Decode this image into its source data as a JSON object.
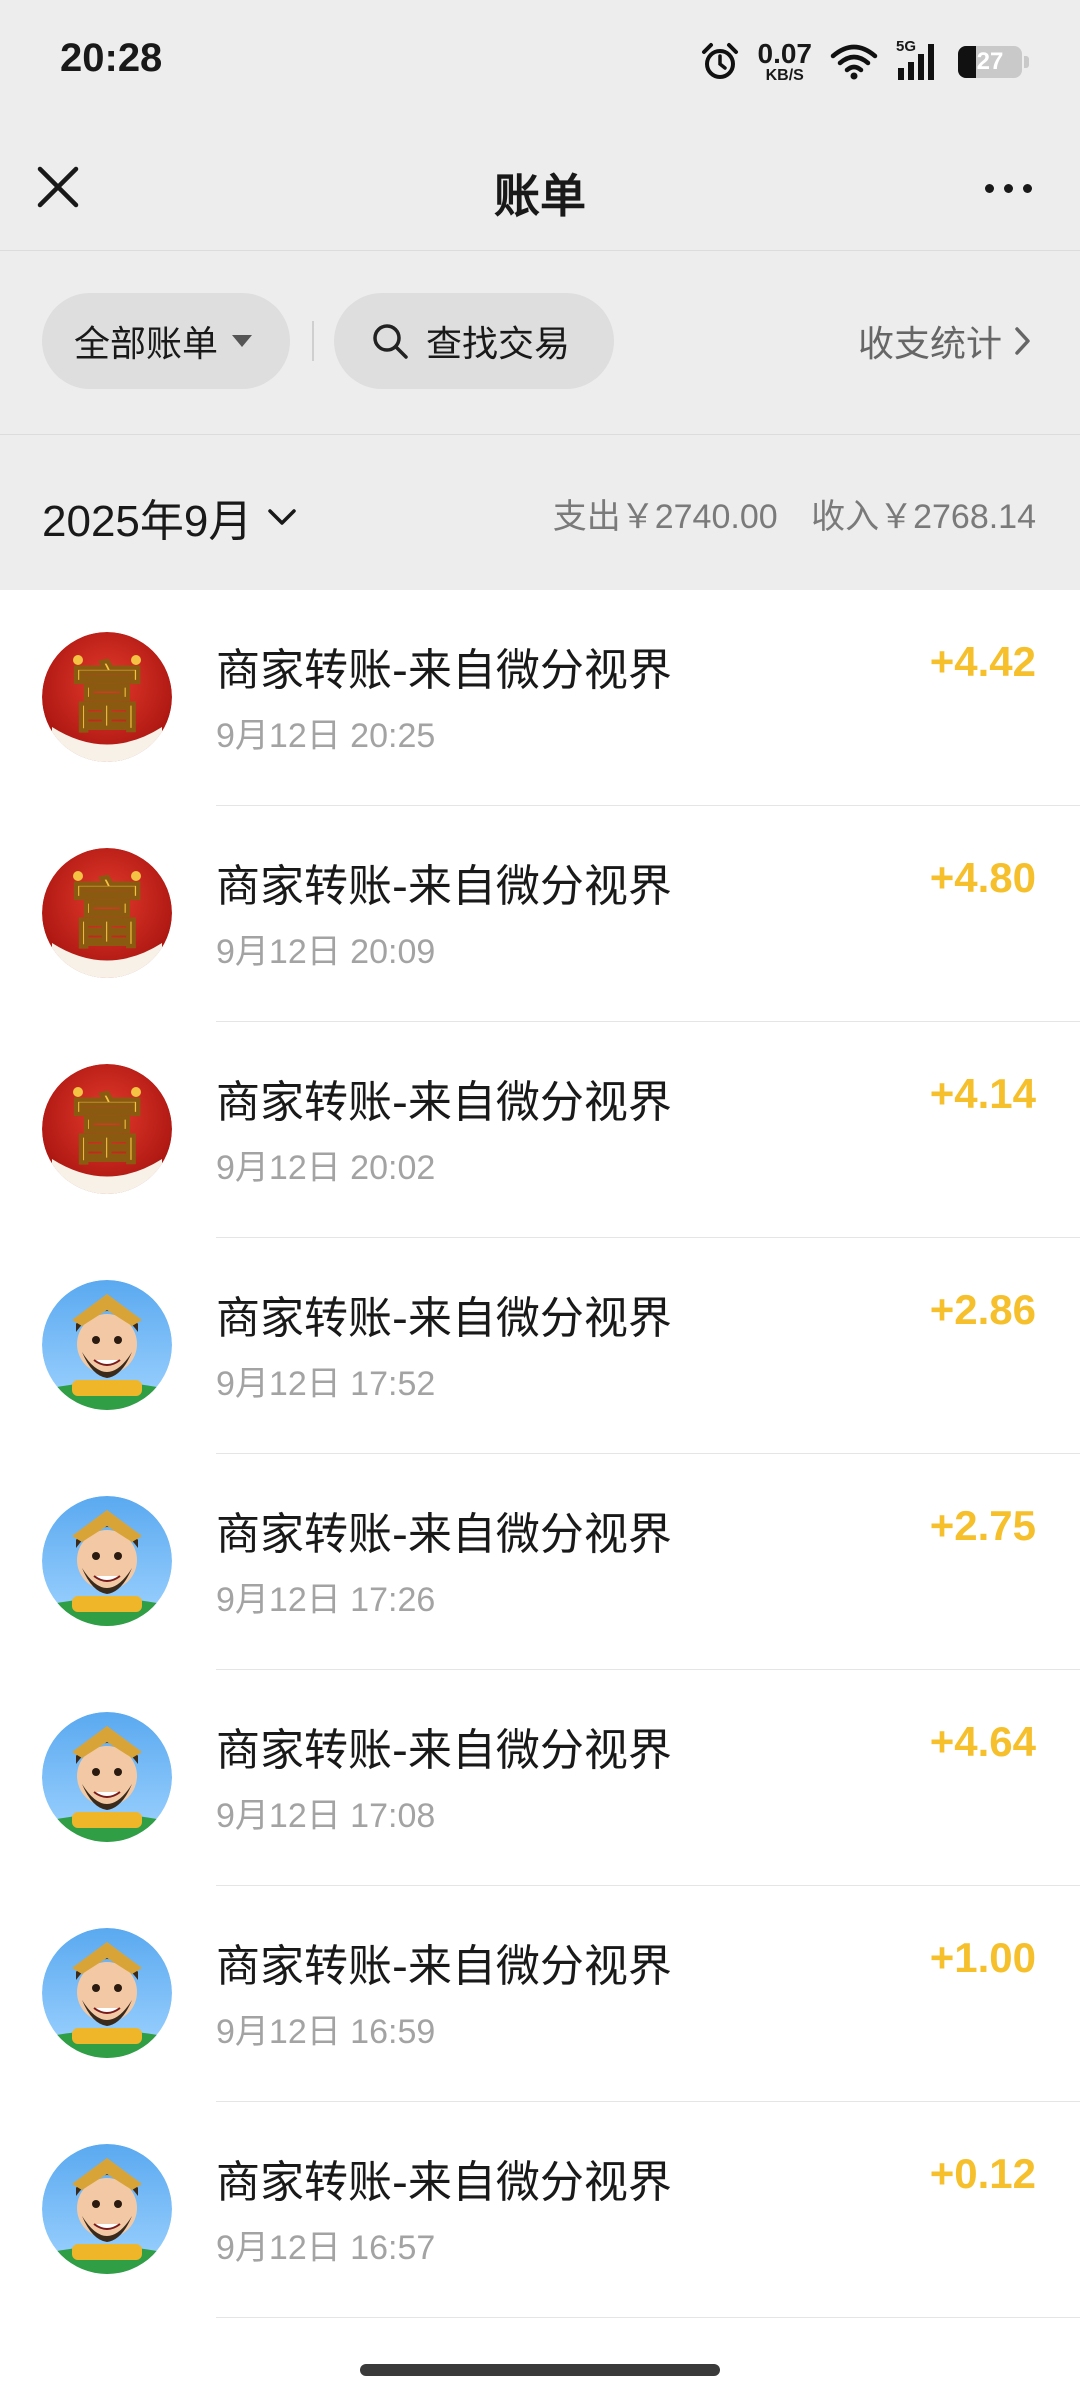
{
  "status_bar": {
    "time": "20:28",
    "net_speed_value": "0.07",
    "net_speed_unit": "KB/S",
    "network_type": "5G",
    "battery_level": "27",
    "icons": [
      "alarm-icon",
      "wifi-icon",
      "signal-icon",
      "battery-icon"
    ]
  },
  "nav": {
    "title": "账单",
    "close_icon": "close-icon",
    "more_icon": "more-icon"
  },
  "filters": {
    "all_bills_label": "全部账单",
    "search_label": "查找交易",
    "stats_label": "收支统计"
  },
  "month_header": {
    "month": "2025年9月",
    "expense": "支出￥2740.00",
    "income": "收入￥2768.14"
  },
  "transactions": [
    {
      "title": "商家转账-来自微分视界",
      "time": "9月12日 20:25",
      "amount": "+4.42",
      "avatar": "fu-avatar"
    },
    {
      "title": "商家转账-来自微分视界",
      "time": "9月12日 20:09",
      "amount": "+4.80",
      "avatar": "fu-avatar"
    },
    {
      "title": "商家转账-来自微分视界",
      "time": "9月12日 20:02",
      "amount": "+4.14",
      "avatar": "fu-avatar"
    },
    {
      "title": "商家转账-来自微分视界",
      "time": "9月12日 17:52",
      "amount": "+2.86",
      "avatar": "caishen-avatar"
    },
    {
      "title": "商家转账-来自微分视界",
      "time": "9月12日 17:26",
      "amount": "+2.75",
      "avatar": "caishen-avatar"
    },
    {
      "title": "商家转账-来自微分视界",
      "time": "9月12日 17:08",
      "amount": "+4.64",
      "avatar": "caishen-avatar"
    },
    {
      "title": "商家转账-来自微分视界",
      "time": "9月12日 16:59",
      "amount": "+1.00",
      "avatar": "caishen-avatar"
    },
    {
      "title": "商家转账-来自微分视界",
      "time": "9月12日 16:57",
      "amount": "+0.12",
      "avatar": "caishen-avatar"
    }
  ],
  "avatar_glyph": "富",
  "colors": {
    "background": "#ededed",
    "list_background": "#ffffff",
    "amount": "#f6c02c",
    "secondary_text": "#a3a3a3",
    "fu_red": "#c8211b",
    "fu_gold": "#f5c343"
  }
}
